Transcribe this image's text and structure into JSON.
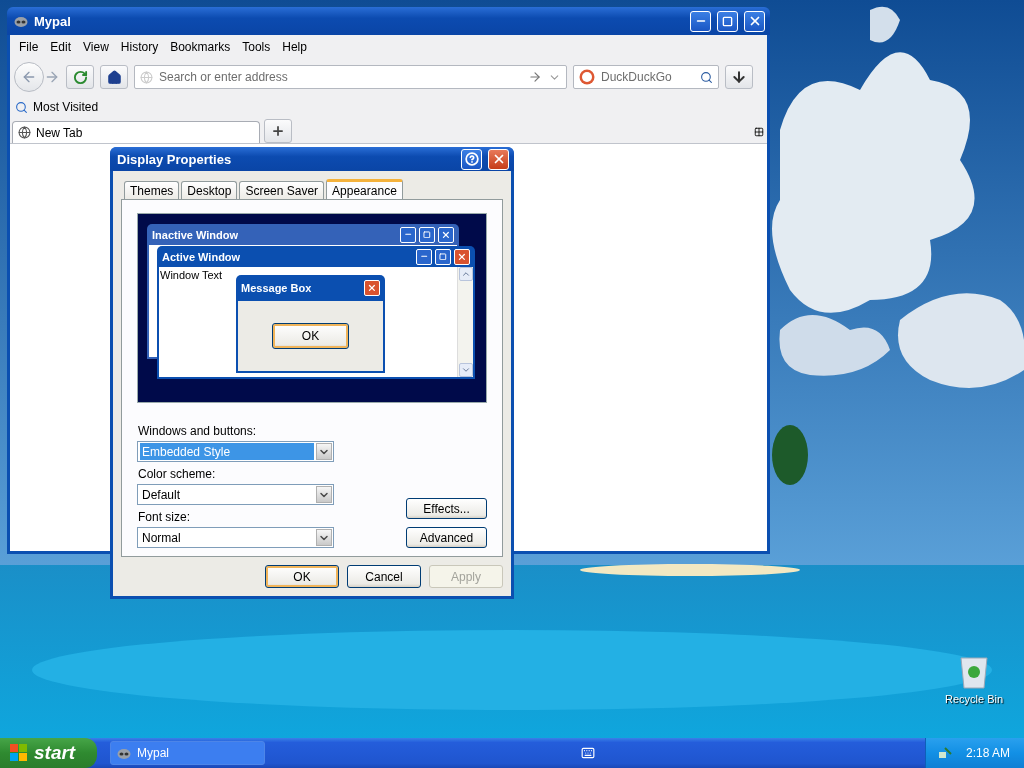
{
  "desktop": {
    "icons": [
      {
        "label": "Recycle Bin"
      }
    ]
  },
  "browser": {
    "title": "Mypal",
    "menu": [
      "File",
      "Edit",
      "View",
      "History",
      "Bookmarks",
      "Tools",
      "Help"
    ],
    "address": {
      "placeholder": "Search or enter address"
    },
    "search": {
      "placeholder": "DuckDuckGo"
    },
    "bookmarks": [
      "Most Visited"
    ],
    "tabs": [
      {
        "label": "New Tab",
        "selected": true
      }
    ]
  },
  "dialog": {
    "title": "Display Properties",
    "tabs": [
      {
        "label": "Themes",
        "selected": false
      },
      {
        "label": "Desktop",
        "selected": false
      },
      {
        "label": "Screen Saver",
        "selected": false
      },
      {
        "label": "Appearance",
        "selected": true
      }
    ],
    "preview": {
      "inactive_title": "Inactive Window",
      "active_title": "Active Window",
      "window_text": "Window Text",
      "message_title": "Message Box",
      "message_button": "OK"
    },
    "fields": [
      {
        "label": "Windows and buttons:",
        "value": "Embedded Style",
        "selected": true
      },
      {
        "label": "Color scheme:",
        "value": "Default",
        "selected": false
      },
      {
        "label": "Font size:",
        "value": "Normal",
        "selected": false
      }
    ],
    "side_buttons": [
      "Effects...",
      "Advanced"
    ],
    "buttons": [
      {
        "label": "OK",
        "default": true,
        "disabled": false
      },
      {
        "label": "Cancel",
        "default": false,
        "disabled": false
      },
      {
        "label": "Apply",
        "default": false,
        "disabled": true
      }
    ]
  },
  "taskbar": {
    "start": "start",
    "tasks": [
      {
        "label": "Mypal",
        "selected": false
      }
    ],
    "clock": "2:18 AM"
  }
}
